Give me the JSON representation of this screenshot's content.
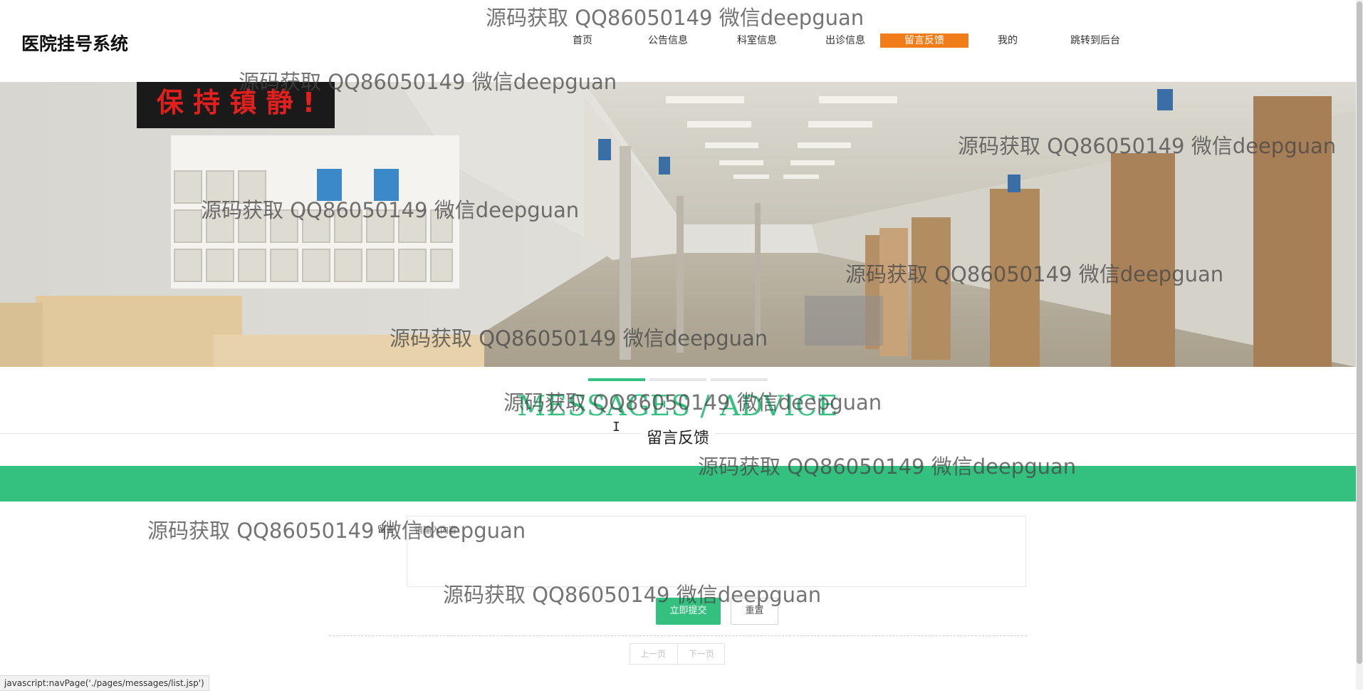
{
  "header": {
    "logo": "医院挂号系统",
    "nav": [
      {
        "label": "首页",
        "active": false
      },
      {
        "label": "公告信息",
        "active": false
      },
      {
        "label": "科室信息",
        "active": false
      },
      {
        "label": "出诊信息",
        "active": false
      },
      {
        "label": "留言反馈",
        "active": true
      },
      {
        "label": "我的",
        "active": false
      },
      {
        "label": "跳转到后台",
        "active": false
      }
    ],
    "active_color": "#f07c1a"
  },
  "banner": {
    "sign_text": "保 持 镇 静 !",
    "carousel_count": 3,
    "carousel_active_index": 0
  },
  "section": {
    "title_en": "MESSAGES / ADVICE",
    "title_cn": "留言反馈",
    "accent_color": "#34c17f"
  },
  "form": {
    "label": "留言",
    "placeholder": "请输入内容",
    "submit_label": "立即提交",
    "reset_label": "重置"
  },
  "pager": {
    "prev_label": "上一页",
    "next_label": "下一页"
  },
  "statusbar": {
    "text": "javascript:navPage('./pages/messages/list.jsp')"
  },
  "watermark": {
    "text": "源码获取 QQ86050149 微信deepguan"
  }
}
